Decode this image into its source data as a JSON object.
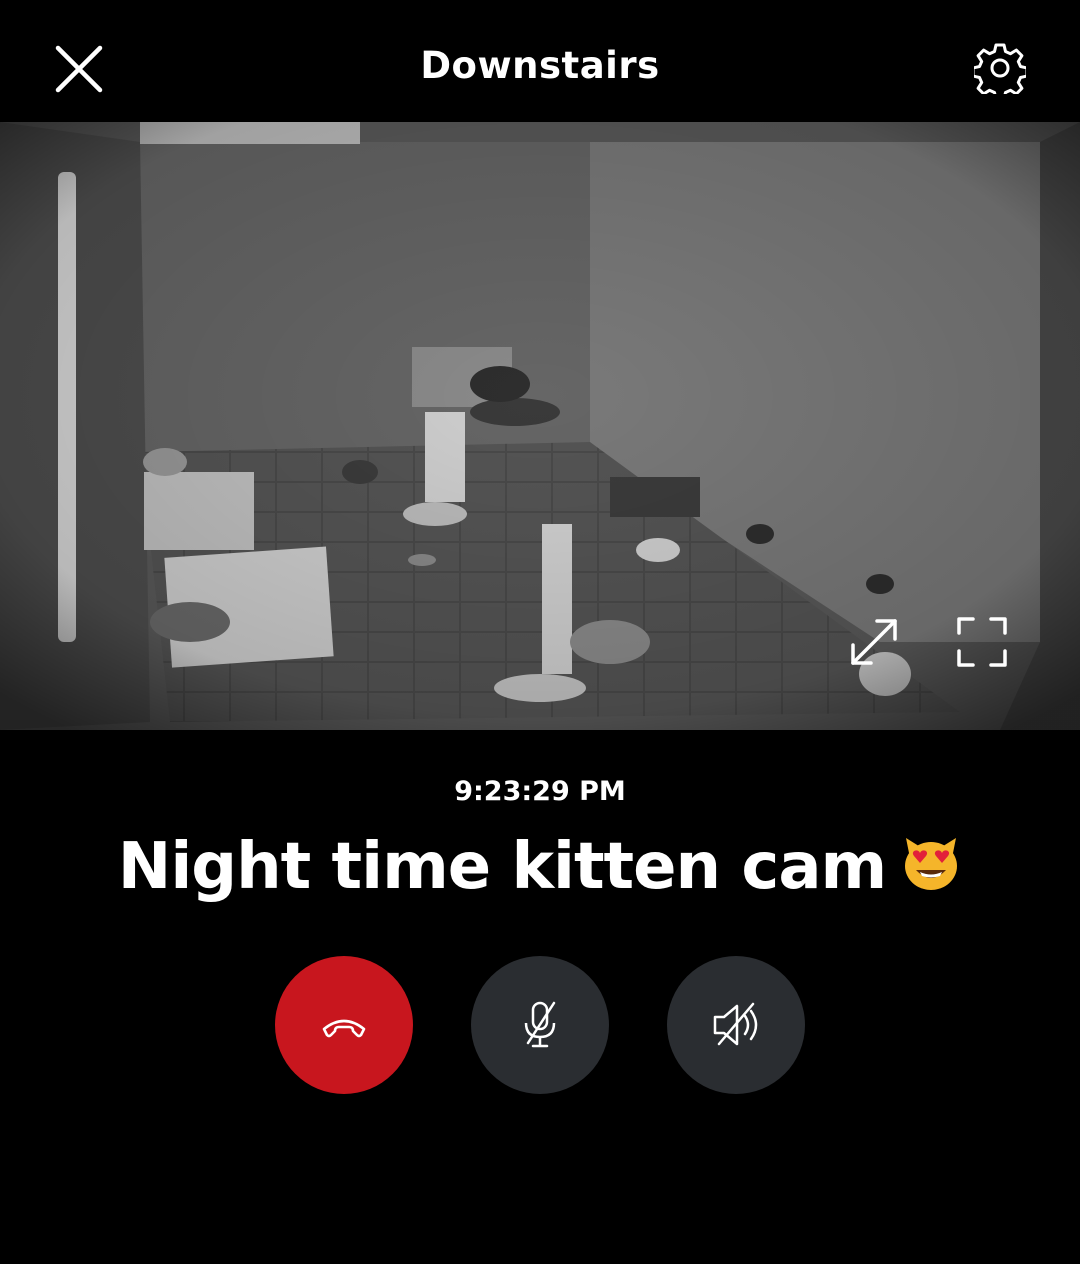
{
  "header": {
    "title": "Downstairs",
    "close_icon": "close-icon",
    "settings_icon": "gear-icon"
  },
  "video": {
    "expand_icon": "expand-arrows-icon",
    "fullscreen_icon": "fullscreen-corners-icon"
  },
  "timestamp": "9:23:29 PM",
  "caption": {
    "text": "Night time kitten cam",
    "emoji": "smiling-cat-heart-eyes-emoji"
  },
  "controls": {
    "end_call_icon": "hang-up-phone-icon",
    "mic_icon": "microphone-muted-icon",
    "speaker_icon": "speaker-muted-icon"
  },
  "colors": {
    "end_call": "#c8161e",
    "control_bg": "#2a2d31",
    "background": "#000000"
  }
}
